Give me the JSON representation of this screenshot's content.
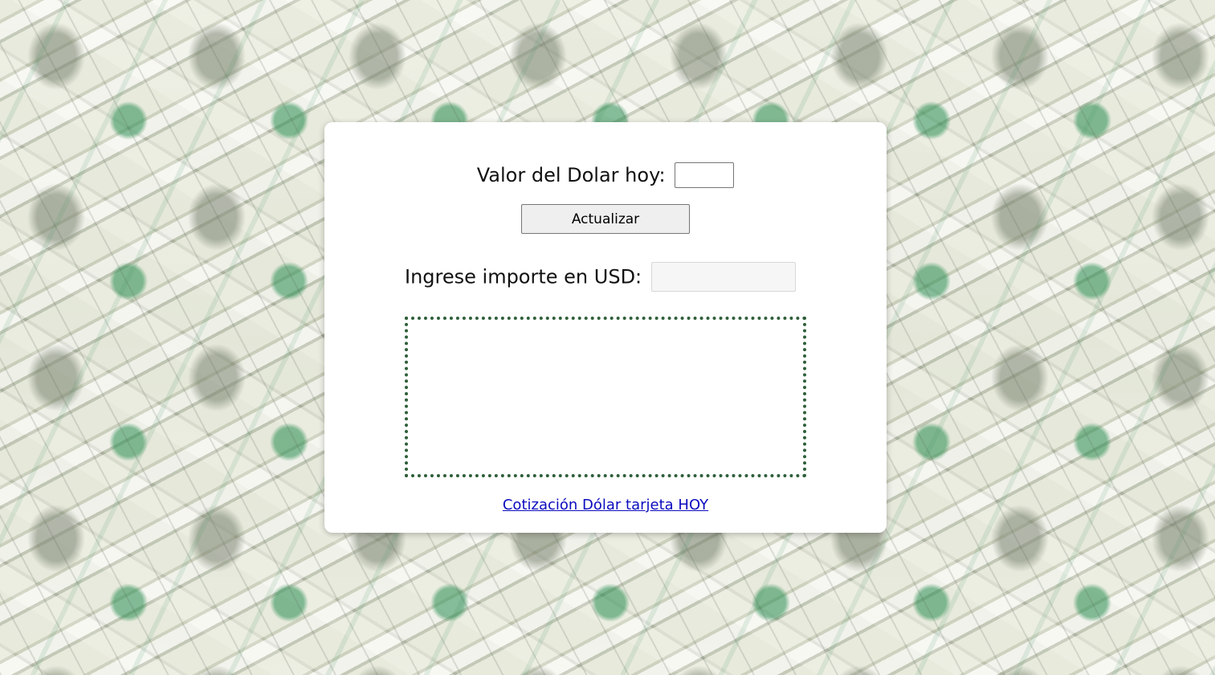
{
  "converter": {
    "rate_label": "Valor del Dolar hoy:",
    "rate_value": "",
    "update_button_label": "Actualizar",
    "amount_label": "Ingrese importe en USD:",
    "amount_value": "",
    "result_text": "",
    "link_text": "Cotización Dólar tarjeta HOY"
  },
  "colors": {
    "card_background": "#ffffff",
    "result_border": "#2f5f3a",
    "link": "#0b0bbf"
  }
}
